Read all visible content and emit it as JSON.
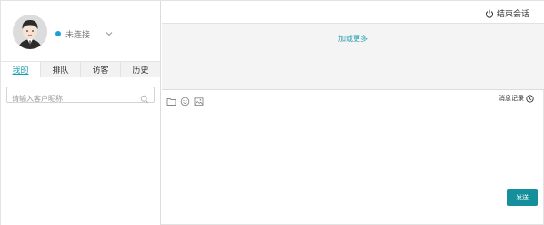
{
  "agent": {
    "avatar_icon": "user-avatar-icon",
    "status_text": "未连接",
    "status_color": "#1a9fd9"
  },
  "tabs": [
    {
      "label": "我的",
      "active": true
    },
    {
      "label": "排队",
      "active": false
    },
    {
      "label": "访客",
      "active": false
    },
    {
      "label": "历史",
      "active": false
    }
  ],
  "search": {
    "placeholder": "请输入客户昵称",
    "value": ""
  },
  "header": {
    "end_session_label": "结束会话"
  },
  "chat": {
    "load_more_label": "加载更多"
  },
  "toolbar": {
    "icons": [
      "folder-icon",
      "emoji-icon",
      "image-icon"
    ],
    "records_label": "消息记录"
  },
  "composer": {
    "value": "",
    "send_label": "发送"
  },
  "colors": {
    "accent": "#1a9fb0",
    "send_button": "#168f9c",
    "history_bg": "#f4f4f4"
  }
}
